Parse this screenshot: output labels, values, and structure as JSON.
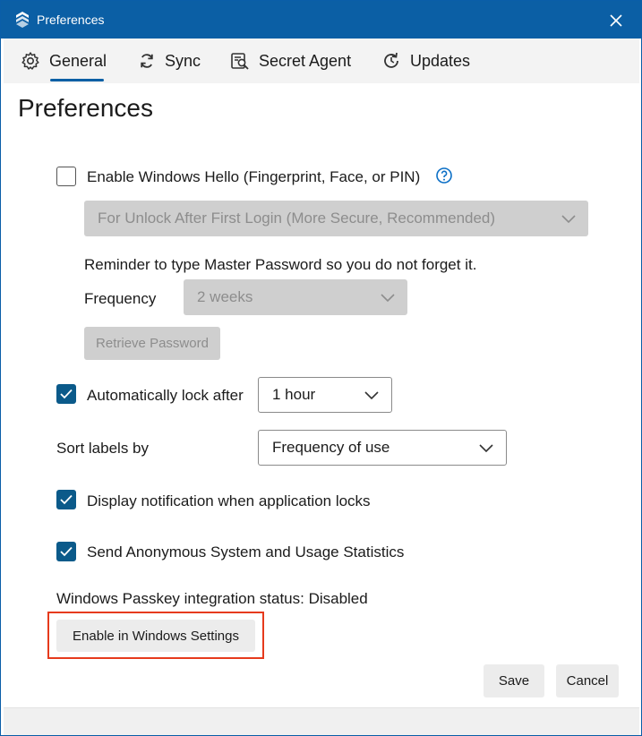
{
  "window": {
    "title": "Preferences",
    "colors": {
      "titlebar": "#0b5fa5",
      "accent": "#0b5a8a",
      "highlight": "#e63a1c"
    }
  },
  "tabs": [
    {
      "label": "General",
      "icon": "gear-icon",
      "selected": true
    },
    {
      "label": "Sync",
      "icon": "sync-icon"
    },
    {
      "label": "Secret Agent",
      "icon": "secret-agent-icon"
    },
    {
      "label": "Updates",
      "icon": "updates-icon"
    }
  ],
  "page": {
    "heading": "Preferences",
    "windows_hello": {
      "label": "Enable Windows Hello (Fingerprint, Face, or PIN)",
      "checked": false,
      "mode_select": "For Unlock After First Login (More Secure, Recommended)",
      "reminder_text": "Reminder to type Master Password so you do not forget it.",
      "frequency_label": "Frequency",
      "frequency_value": "2 weeks",
      "retrieve_button": "Retrieve Password"
    },
    "auto_lock": {
      "label": "Automatically lock after",
      "checked": true,
      "value": "1 hour"
    },
    "sort": {
      "label": "Sort labels by",
      "value": "Frequency of use"
    },
    "notify_lock": {
      "label": "Display notification when application locks",
      "checked": true
    },
    "statistics": {
      "label": "Send Anonymous System and Usage Statistics",
      "checked": true
    },
    "passkey": {
      "status_text": "Windows Passkey integration status: Disabled",
      "enable_button": "Enable in Windows Settings"
    },
    "actions": {
      "save": "Save",
      "cancel": "Cancel"
    }
  }
}
